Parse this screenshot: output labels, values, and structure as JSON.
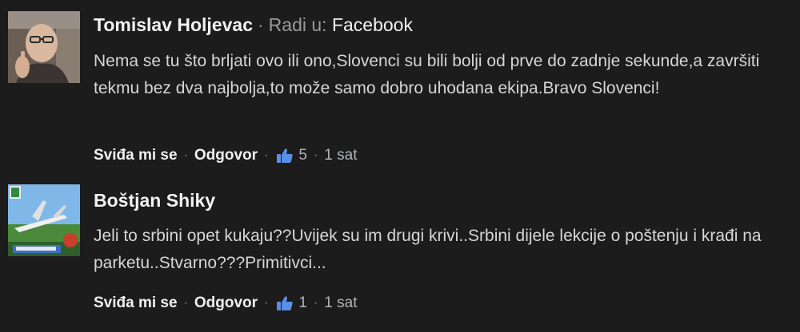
{
  "comments": [
    {
      "author": "Tomislav Holjevac",
      "works_at_label": "Radi u:",
      "works_at_org": "Facebook",
      "text": "Nema se tu što brljati ovo ili ono,Slovenci su bili bolji od prve do zadnje sekunde,a završiti tekmu bez dva najbolja,to može samo dobro uhodana ekipa.Bravo Slovenci!",
      "like_label": "Sviđa mi se",
      "reply_label": "Odgovor",
      "likes": "5",
      "time": "1 sat",
      "like_icon": "thumbs-up-icon"
    },
    {
      "author": "Boštjan Shiky",
      "text": "Jeli to srbini opet kukaju??Uvijek su im drugi krivi..Srbini dijele lekcije o poštenju i krađi na parketu..Stvarno???Primitivci...",
      "like_label": "Sviđa mi se",
      "reply_label": "Odgovor",
      "likes": "1",
      "time": "1 sat",
      "like_icon": "thumbs-up-icon"
    }
  ],
  "colors": {
    "background": "#1c1c1c",
    "text": "#d6d6d6",
    "muted": "#b0b3b8",
    "like_blue": "#5b8ee6"
  }
}
